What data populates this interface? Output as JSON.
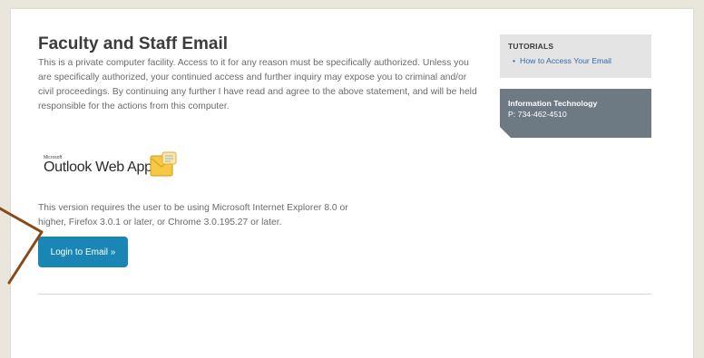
{
  "page": {
    "title": "Faculty and Staff Email",
    "disclaimer": "This is a private computer facility. Access to it for any reason must be specifically authorized. Unless you are specifically authorized, your continued access and further inquiry may expose you to criminal and/or civil proceedings. By continuing any further I have read and agree to the above statement, and will be held responsible for the actions from this computer.",
    "logo": {
      "small_text": "Microsoft",
      "text": "Outlook Web App",
      "icon": "outlook-envelope-icon"
    },
    "requirements": "This version requires the user to be using Microsoft Internet Explorer 8.0 or higher, Firefox 3.0.1 or later, or Chrome 3.0.195.27 or later.",
    "login_button": "Login to Email »"
  },
  "sidebar": {
    "tutorials": {
      "heading": "TUTORIALS",
      "items": [
        {
          "label": "How to Access Your Email"
        }
      ]
    },
    "contact": {
      "title": "Information Technology",
      "phone": "P: 734-462-4510"
    }
  },
  "colors": {
    "accent": "#1a86b5",
    "contact_box": "#6d7a84",
    "annotation_arrow": "#8a4a17"
  }
}
